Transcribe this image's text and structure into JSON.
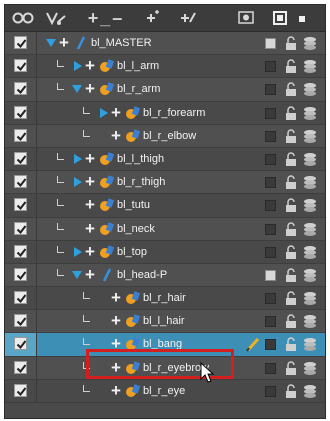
{
  "toolbar": {
    "icons": [
      "show-hide-all-icon",
      "animate-mode-icon",
      "add-layer-icon",
      "remove-layer-icon",
      "add-peg-icon",
      "add-drawing-icon",
      "camera-view-icon",
      "layer-color-icon",
      "lock-all-icon"
    ],
    "plus_minus": "+_–"
  },
  "layers": [
    {
      "name": "bl_MASTER",
      "depth": 0,
      "arrow": "down",
      "icon": "peg-slash",
      "color": "light",
      "checked": true
    },
    {
      "name": "bl_l_arm",
      "depth": 1,
      "arrow": "right",
      "icon": "drawing",
      "color": "dark",
      "checked": true
    },
    {
      "name": "bl_r_arm",
      "depth": 1,
      "arrow": "down",
      "icon": "drawing",
      "color": "dark",
      "checked": true
    },
    {
      "name": "bl_r_forearm",
      "depth": 2,
      "arrow": "right",
      "icon": "drawing",
      "color": "dark",
      "checked": true
    },
    {
      "name": "bl_r_elbow",
      "depth": 2,
      "arrow": "none",
      "icon": "drawing",
      "color": "dark",
      "checked": true
    },
    {
      "name": "bl_l_thigh",
      "depth": 1,
      "arrow": "right",
      "icon": "drawing",
      "color": "dark",
      "checked": true
    },
    {
      "name": "bl_r_thigh",
      "depth": 1,
      "arrow": "right",
      "icon": "drawing",
      "color": "dark",
      "checked": true
    },
    {
      "name": "bl_tutu",
      "depth": 1,
      "arrow": "none",
      "icon": "drawing",
      "color": "dark",
      "checked": true
    },
    {
      "name": "bl_neck",
      "depth": 1,
      "arrow": "none",
      "icon": "drawing",
      "color": "dark",
      "checked": true
    },
    {
      "name": "bl_top",
      "depth": 1,
      "arrow": "right",
      "icon": "drawing",
      "color": "dark",
      "checked": true
    },
    {
      "name": "bl_head-P",
      "depth": 1,
      "arrow": "down",
      "icon": "peg-slash",
      "color": "light",
      "checked": true
    },
    {
      "name": "bl_r_hair",
      "depth": 2,
      "arrow": "none",
      "icon": "drawing",
      "color": "dark",
      "checked": true
    },
    {
      "name": "bl_l_hair",
      "depth": 2,
      "arrow": "none",
      "icon": "drawing",
      "color": "dark",
      "checked": true
    },
    {
      "name": "bl_bang",
      "depth": 2,
      "arrow": "none",
      "icon": "drawing",
      "color": "dark",
      "checked": true,
      "selected": true
    },
    {
      "name": "bl_r_eyebrow",
      "depth": 2,
      "arrow": "none",
      "icon": "drawing",
      "color": "dark",
      "checked": true
    },
    {
      "name": "bl_r_eye",
      "depth": 2,
      "arrow": "none",
      "icon": "drawing",
      "color": "dark",
      "checked": true
    }
  ],
  "colors": {
    "selection": "#3e8fb5",
    "highlight_box": "#d41f1f",
    "drawing_orange": "#f0a020",
    "drawing_blue": "#3a7fd0"
  }
}
